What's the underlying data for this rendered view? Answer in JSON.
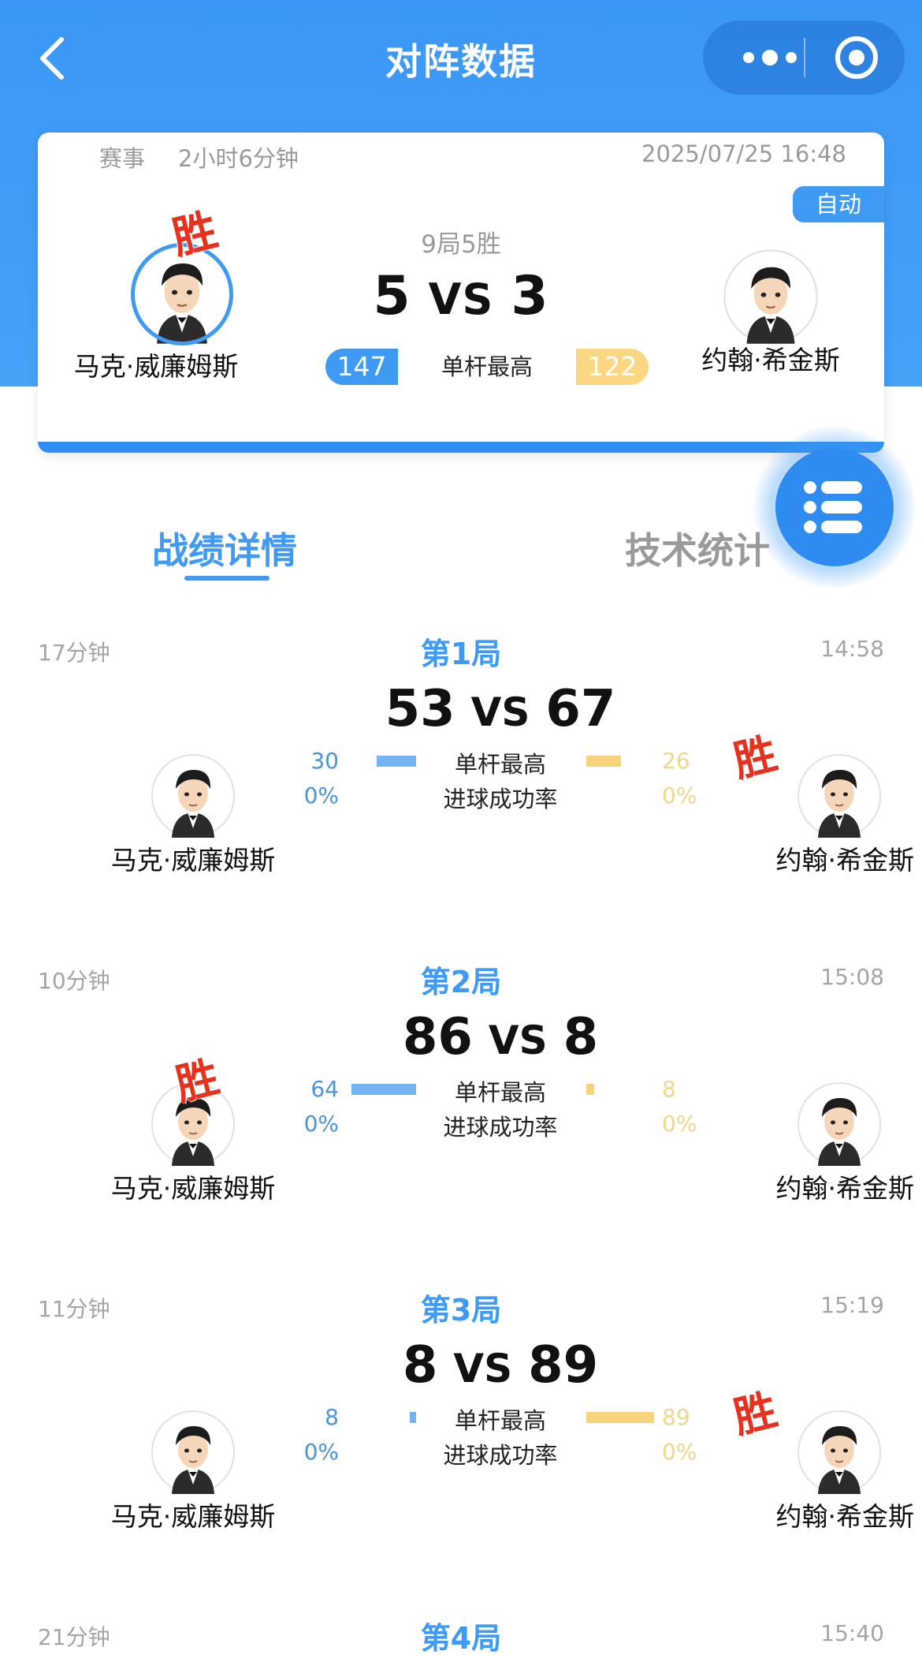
{
  "nav": {
    "title": "对阵数据"
  },
  "match": {
    "event_label": "赛事",
    "duration": "2小时6分钟",
    "datetime": "2025/07/25 16:48",
    "auto_label": "自动",
    "format": "9局5胜",
    "score_left": "5",
    "vs": "VS",
    "score_right": "3",
    "player1": "马克·威廉姆斯",
    "player2": "约翰·希金斯",
    "highest_break_label": "单杆最高",
    "highest_break_left": "147",
    "highest_break_right": "122",
    "winner_stamp": "胜"
  },
  "tabs": {
    "record": "战绩详情",
    "stats": "技术统计"
  },
  "frames": [
    {
      "duration": "17分钟",
      "title": "第1局",
      "time": "14:58",
      "score_left": "53",
      "vs": "VS",
      "score_right": "67",
      "hb_left": "30",
      "hb_right": "26",
      "rate_left": "0%",
      "rate_right": "0%",
      "hb_label": "单杆最高",
      "rate_label": "进球成功率",
      "player1": "马克·威廉姆斯",
      "player2": "约翰·希金斯",
      "winner": "right",
      "winner_stamp": "胜"
    },
    {
      "duration": "10分钟",
      "title": "第2局",
      "time": "15:08",
      "score_left": "86",
      "vs": "VS",
      "score_right": "8",
      "hb_left": "64",
      "hb_right": "8",
      "rate_left": "0%",
      "rate_right": "0%",
      "hb_label": "单杆最高",
      "rate_label": "进球成功率",
      "player1": "马克·威廉姆斯",
      "player2": "约翰·希金斯",
      "winner": "left",
      "winner_stamp": "胜"
    },
    {
      "duration": "11分钟",
      "title": "第3局",
      "time": "15:19",
      "score_left": "8",
      "vs": "VS",
      "score_right": "89",
      "hb_left": "8",
      "hb_right": "89",
      "rate_left": "0%",
      "rate_right": "0%",
      "hb_label": "单杆最高",
      "rate_label": "进球成功率",
      "player1": "马克·威廉姆斯",
      "player2": "约翰·希金斯",
      "winner": "right",
      "winner_stamp": "胜"
    },
    {
      "duration": "21分钟",
      "title": "第4局",
      "time": "15:40"
    }
  ],
  "colors": {
    "accent": "#3f9af4",
    "left_bar": "#75b4f2",
    "right_bar": "#f9d27c",
    "win_stamp": "#e5311e"
  },
  "icons": [
    "back-arrow-icon",
    "more-dots-icon",
    "target-icon",
    "list-menu-icon"
  ]
}
